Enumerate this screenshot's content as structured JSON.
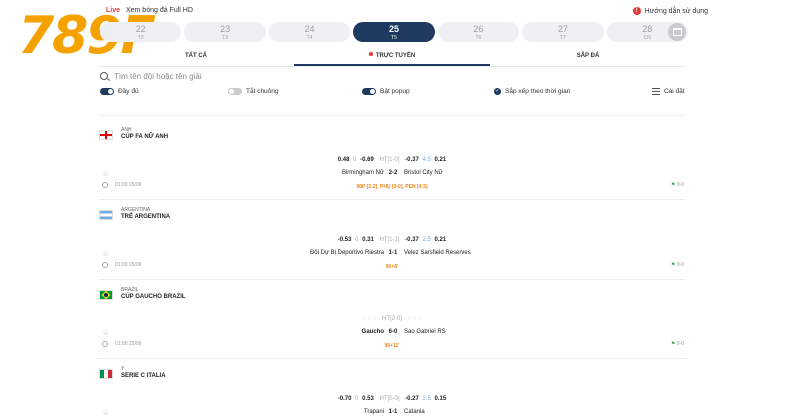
{
  "header": {
    "logo": "789F",
    "live_label": "Live",
    "watch_text": "Xem bóng đá Full HD",
    "guide_text": "Hướng dẫn sử dụng",
    "guide_icon": "warning-icon"
  },
  "dates": [
    {
      "day": "22",
      "wd": "T2"
    },
    {
      "day": "23",
      "wd": "T3"
    },
    {
      "day": "24",
      "wd": "T4"
    },
    {
      "day": "25",
      "wd": "T5",
      "active": true
    },
    {
      "day": "26",
      "wd": "T6"
    },
    {
      "day": "27",
      "wd": "T7"
    },
    {
      "day": "28",
      "wd": "CN"
    }
  ],
  "tabs": {
    "all": "TẤT CẢ",
    "live": "TRỰC TUYẾN",
    "upcoming": "SẮP ĐÁ"
  },
  "search": {
    "placeholder": "Tìm tên đội hoặc tên giải"
  },
  "filters": {
    "full": "Đầy đủ",
    "mute": "Tắt chuông",
    "popup": "Bật popup",
    "sort": "Sắp xếp theo thời gian",
    "settings": "Cài đặt"
  },
  "leagues": [
    {
      "country": "ANH",
      "name": "CÚP FA NỮ ANH",
      "match": {
        "o1": "0.48",
        "o2": "0",
        "o3": "-0.69",
        "ht": "HT[1-0]",
        "o4": "-0.37",
        "o5": "4.5",
        "o6": "0.21",
        "home": "Birmingham Nữ",
        "score": "2-2",
        "away": "Bristol City Nữ",
        "extra": "90P [2-2], PHỤ [0-0], PEN [4-3]",
        "kickoff": "01:00 25/09",
        "corner": "0-0"
      }
    },
    {
      "country": "ARGENTINA",
      "name": "TRẺ ARGENTINA",
      "match": {
        "o1": "-0.53",
        "o2": "0",
        "o3": "0.31",
        "ht": "HT[1-1]",
        "o4": "-0.37",
        "o5": "2.5",
        "o6": "0.21",
        "home": "Đội Dự Bị Deportivo Riestra",
        "score": "1-1",
        "away": "Velez Sarsfield Reserves",
        "extra": "90+8'",
        "kickoff": "01:00 25/09",
        "corner": "0-0"
      }
    },
    {
      "country": "BRAZIL",
      "name": "CÚP GAUCHO BRAZIL",
      "match": {
        "o1": "",
        "o2": "",
        "o3": "",
        "ht": "HT[2-0]",
        "o4": "",
        "o5": "",
        "o6": "",
        "home": "Gaucho",
        "score": "6-0",
        "away": "Sao Gabriel RS",
        "extra": "90+11'",
        "kickoff": "01:00 25/09",
        "corner": "0-0"
      }
    },
    {
      "country": "Ý",
      "name": "SERIE C ITALIA",
      "match": {
        "o1": "-0.70",
        "o2": "0",
        "o3": "0.53",
        "ht": "HT[0-0]",
        "o4": "-0.27",
        "o5": "2.5",
        "o6": "0.15",
        "home": "Trapani",
        "score": "1-1",
        "away": "Catania",
        "extra": "",
        "kickoff": "",
        "corner": ""
      }
    }
  ],
  "colors": {
    "brand": "#f5a200",
    "primary": "#1e3a5f",
    "live": "#e53935",
    "extra": "#e6861b"
  }
}
